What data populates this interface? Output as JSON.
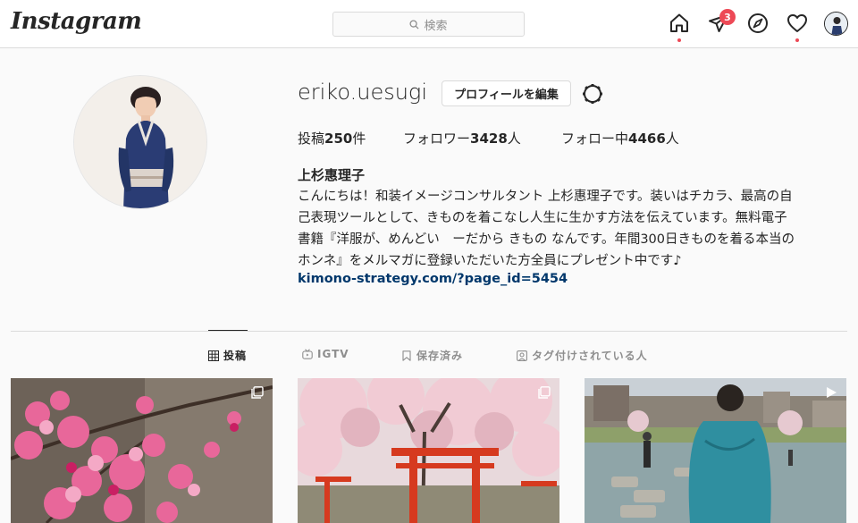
{
  "header": {
    "logo": "Instagram",
    "search_placeholder": "検索",
    "notification_count": "3"
  },
  "profile": {
    "username": "eriko.uesugi",
    "edit_button": "プロフィールを編集",
    "stats": {
      "posts_label": "投稿",
      "posts_count": "250",
      "posts_unit": "件",
      "followers_label": "フォロワー",
      "followers_count": "3428",
      "followers_unit": "人",
      "following_label": "フォロー中",
      "following_count": "4466",
      "following_unit": "人"
    },
    "full_name": "上杉惠理子",
    "bio_lines": [
      "こんにちは！和装イメージコンサルタント 上杉惠理子です。装いはチカラ、最高の自",
      "己表現ツールとして、きものを着こなし人生に生かす方法を伝えています。無料電子",
      "書籍『洋服が、めんどい　ーだから きもの なんです。年間300日きものを着る本当の",
      "ホンネ』をメルマガに登録いただいた方全員にプレゼント中です♪"
    ],
    "link": "kimono-strategy.com/?page_id=5454"
  },
  "tabs": {
    "posts": "投稿",
    "igtv": "IGTV",
    "saved": "保存済み",
    "tagged": "タグ付けされている人"
  },
  "colors": {
    "accent_red": "#ed4956",
    "link_blue": "#00376b",
    "border": "#dbdbdb"
  }
}
